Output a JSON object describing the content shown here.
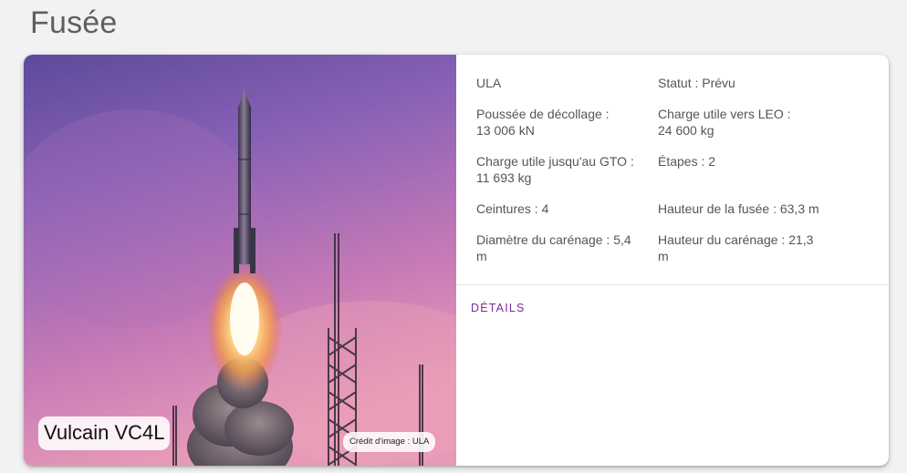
{
  "section": {
    "title": "Fusée"
  },
  "card": {
    "image": {
      "rocket_name": "Vulcain VC4L",
      "credit": "Crédit d'image : ULA"
    },
    "rows": [
      {
        "left": "ULA",
        "right": "Statut : Prévu"
      },
      {
        "left": "Poussée de décollage : 13 006 kN",
        "right": "Charge utile vers LEO : 24 600 kg"
      },
      {
        "left": "Charge utile jusqu'au GTO : 11 693 kg",
        "right": "Étapes : 2"
      },
      {
        "left": "Ceintures : 4",
        "right": "Hauteur de la fusée : 63,3 m"
      },
      {
        "left": "Diamètre du carénage : 5,4 m",
        "right": "Hauteur du carénage : 21,3 m"
      }
    ],
    "details_label": "DÉTAILS"
  },
  "colors": {
    "title": "#5f5f5f",
    "text": "#555555",
    "accent": "#7b2c9a",
    "sky_top": "#6b4fa3",
    "sky_bottom": "#e38ab5"
  }
}
